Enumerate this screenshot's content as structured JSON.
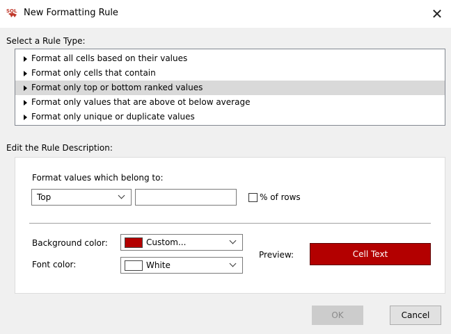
{
  "window": {
    "title": "New Formatting Rule",
    "close_symbol": "✕",
    "icon": "sql-app-icon"
  },
  "rule_type": {
    "label": "Select a Rule Type:",
    "items": [
      {
        "label": "Format all cells based on their values",
        "selected": false
      },
      {
        "label": "Format only cells that contain",
        "selected": false
      },
      {
        "label": "Format only top or bottom ranked values",
        "selected": true
      },
      {
        "label": "Format only values that are above ot below average",
        "selected": false
      },
      {
        "label": "Format only unique or duplicate values",
        "selected": false
      }
    ]
  },
  "description": {
    "label": "Edit the Rule Description:",
    "format_label": "Format values which belong to:",
    "rank_select": "Top",
    "rank_value": "",
    "percent_label": "% of rows",
    "percent_checked": false,
    "bg_label": "Background color:",
    "bg_value": "Custom...",
    "bg_color": "#b30000",
    "font_label": "Font color:",
    "font_value": "White",
    "font_color": "#ffffff",
    "preview_label": "Preview:",
    "preview_text": "Cell Text"
  },
  "buttons": {
    "ok": "OK",
    "cancel": "Cancel"
  }
}
